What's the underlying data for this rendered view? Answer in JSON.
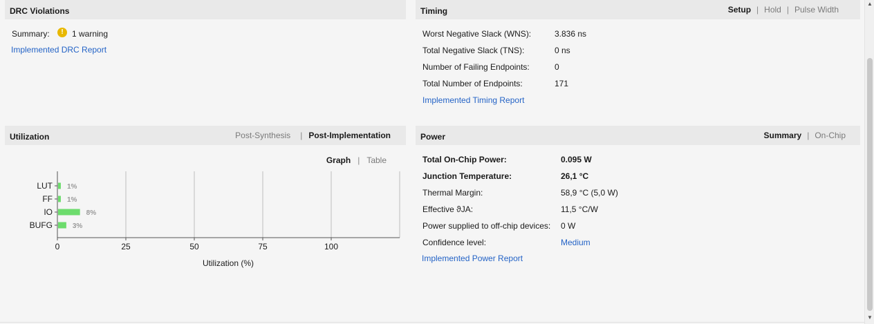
{
  "drc": {
    "title": "DRC Violations",
    "summary_label": "Summary:",
    "warning_icon": "!",
    "summary_value": "1 warning",
    "report_link": "Implemented DRC Report"
  },
  "timing": {
    "title": "Timing",
    "tabs": [
      "Setup",
      "Hold",
      "Pulse Width"
    ],
    "active_tab": "Setup",
    "rows": [
      {
        "label": "Worst Negative Slack (WNS):",
        "value": "3.836 ns"
      },
      {
        "label": "Total Negative Slack (TNS):",
        "value": "0 ns"
      },
      {
        "label": "Number of Failing Endpoints:",
        "value": "0"
      },
      {
        "label": "Total Number of Endpoints:",
        "value": "171"
      }
    ],
    "report_link": "Implemented Timing Report"
  },
  "utilization": {
    "title": "Utilization",
    "tabs": [
      "Post-Synthesis",
      "Post-Implementation"
    ],
    "active_tab": "Post-Implementation",
    "view_tabs": [
      "Graph",
      "Table"
    ],
    "active_view": "Graph",
    "bar_color": "#6ddc6d"
  },
  "chart_data": {
    "type": "bar",
    "orientation": "horizontal",
    "categories": [
      "LUT",
      "FF",
      "IO",
      "BUFG"
    ],
    "values": [
      1,
      1,
      8,
      3
    ],
    "data_labels": [
      "1%",
      "1%",
      "8%",
      "3%"
    ],
    "xlabel": "Utilization (%)",
    "xticks": [
      0,
      25,
      50,
      75,
      100
    ],
    "xlim": [
      0,
      125
    ],
    "grid": true
  },
  "power": {
    "title": "Power",
    "tabs": [
      "Summary",
      "On-Chip"
    ],
    "active_tab": "Summary",
    "rows": [
      {
        "label": "Total On-Chip Power:",
        "value": "0.095 W",
        "bold": true
      },
      {
        "label": "Junction Temperature:",
        "value": "26,1 °C",
        "bold": true
      },
      {
        "label": "Thermal Margin:",
        "value": "58,9 °C (5,0 W)"
      },
      {
        "label": "Effective ϑJA:",
        "value": "11,5 °C/W"
      },
      {
        "label": "Power supplied to off-chip devices:",
        "value": "0 W"
      },
      {
        "label": "Confidence level:",
        "value": "Medium",
        "link": true
      }
    ],
    "report_link": "Implemented Power Report"
  }
}
